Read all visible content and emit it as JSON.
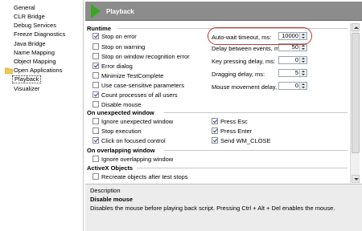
{
  "tree": {
    "items": [
      {
        "label": "General"
      },
      {
        "label": "CLR Bridge"
      },
      {
        "label": "Debug Services"
      },
      {
        "label": "Freeze Diagnostics"
      },
      {
        "label": "Java Bridge"
      },
      {
        "label": "Name Mapping"
      },
      {
        "label": "Object Mapping"
      },
      {
        "label": "Open Applications"
      },
      {
        "label": "Playback"
      },
      {
        "label": "Visualizer"
      }
    ]
  },
  "header": {
    "title": "Playback"
  },
  "sections": {
    "runtime": "Runtime",
    "unexpected": "On unexpected window",
    "overlapping": "On overlapping window",
    "activex": "ActiveX Objects"
  },
  "runtime": {
    "stop_on_error": "Stop on error",
    "stop_on_warning": "Stop on warning",
    "stop_on_window_recognition_error": "Stop on window recognition error",
    "error_dialog": "Error dialog",
    "minimize": "Minimize TestComplete",
    "case_sensitive": "Use case-sensitive parameters",
    "count_processes": "Count processes of all users",
    "disable_mouse": "Disable mouse",
    "auto_wait_label": "Auto-wait timeout, ms:",
    "auto_wait_value": "10000",
    "delay_events_label": "Delay between events, ms:",
    "delay_events_value": "50",
    "key_delay_label": "Key pressing delay, ms:",
    "key_delay_value": "0",
    "drag_delay_label": "Dragging delay, ms:",
    "drag_delay_value": "5",
    "mouse_delay_label": "Mouse movement delay, ms:",
    "mouse_delay_value": "0"
  },
  "unexpected": {
    "ignore": "Ignore unexpected window",
    "stop": "Stop execution",
    "click": "Click on focused control",
    "press_esc": "Press Esc",
    "press_enter": "Press Enter",
    "send_close": "Send WM_CLOSE"
  },
  "overlapping": {
    "ignore": "Ignore overlapping window"
  },
  "activex": {
    "recreate": "Recreate objects after test stops"
  },
  "description": {
    "header": "Description",
    "title": "Disable mouse",
    "text": "Disables the mouse before playing back script. Pressing Ctrl + Alt + Del enables the mouse."
  },
  "colors": {
    "header_bg": "#8c8c8c",
    "play_icon": "#3aa626",
    "highlight_oval": "#c0392b"
  }
}
